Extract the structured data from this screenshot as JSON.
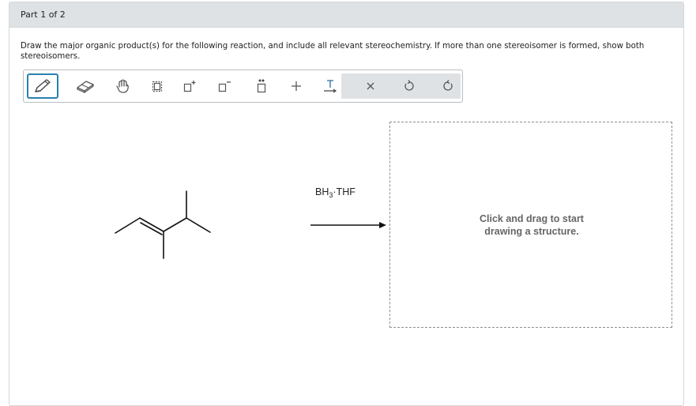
{
  "header": {
    "part_label": "Part 1 of 2"
  },
  "question": {
    "text": "Draw the major organic product(s) for the following reaction, and include all relevant stereochemistry. If more than one stereoisomer is formed, show both stereoisomers."
  },
  "toolbar": {
    "tools": [
      {
        "name": "pencil-icon",
        "active": true
      },
      {
        "name": "eraser-icon",
        "active": false
      },
      {
        "name": "hand-icon",
        "active": false
      },
      {
        "name": "select-icon",
        "active": false
      },
      {
        "name": "positive-charge-icon",
        "active": false
      },
      {
        "name": "negative-charge-icon",
        "active": false
      },
      {
        "name": "lone-pair-icon",
        "active": false
      },
      {
        "name": "plus-icon",
        "active": false
      },
      {
        "name": "arrow-text-icon",
        "active": false
      },
      {
        "name": "clear-icon",
        "active": false
      },
      {
        "name": "undo-icon",
        "active": false
      },
      {
        "name": "redo-icon",
        "active": false
      }
    ],
    "accent_color": "#2a7fb0"
  },
  "reaction": {
    "reagent_main": "BH",
    "reagent_sub": "3",
    "reagent_rest": "·THF"
  },
  "drawing_area": {
    "hint_line1": "Click and drag to start",
    "hint_line2": "drawing a structure."
  }
}
